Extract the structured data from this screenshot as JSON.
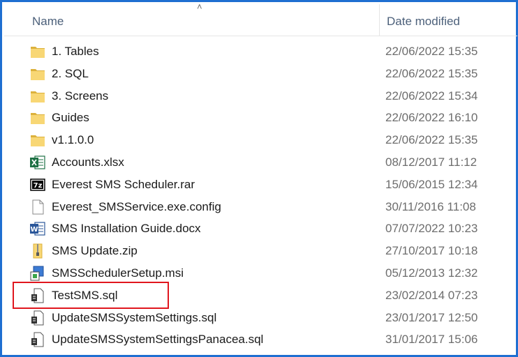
{
  "columns": {
    "name": "Name",
    "date_modified": "Date modified"
  },
  "files": [
    {
      "name": "1. Tables",
      "date": "22/06/2022 15:35",
      "icon": "folder-icon"
    },
    {
      "name": "2. SQL",
      "date": "22/06/2022 15:35",
      "icon": "folder-icon"
    },
    {
      "name": "3. Screens",
      "date": "22/06/2022 15:34",
      "icon": "folder-icon"
    },
    {
      "name": "Guides",
      "date": "22/06/2022 16:10",
      "icon": "folder-icon"
    },
    {
      "name": "v1.1.0.0",
      "date": "22/06/2022 15:35",
      "icon": "folder-icon"
    },
    {
      "name": "Accounts.xlsx",
      "date": "08/12/2017 11:12",
      "icon": "excel-icon"
    },
    {
      "name": "Everest SMS Scheduler.rar",
      "date": "15/06/2015 12:34",
      "icon": "7zip-icon"
    },
    {
      "name": "Everest_SMSService.exe.config",
      "date": "30/11/2016 11:08",
      "icon": "file-icon"
    },
    {
      "name": "SMS Installation Guide.docx",
      "date": "07/07/2022 10:23",
      "icon": "word-icon"
    },
    {
      "name": "SMS Update.zip",
      "date": "27/10/2017 10:18",
      "icon": "zip-folder-icon"
    },
    {
      "name": "SMSSchedulerSetup.msi",
      "date": "05/12/2013 12:32",
      "icon": "installer-icon"
    },
    {
      "name": "TestSMS.sql",
      "date": "23/02/2014 07:23",
      "icon": "sql-file-icon"
    },
    {
      "name": "UpdateSMSSystemSettings.sql",
      "date": "23/01/2017 12:50",
      "icon": "sql-file-icon"
    },
    {
      "name": "UpdateSMSSystemSettingsPanacea.sql",
      "date": "31/01/2017 15:06",
      "icon": "sql-file-icon"
    }
  ],
  "colors": {
    "highlight": "#e0161e",
    "frame": "#1f6fd1",
    "folder": "#f8d775"
  }
}
